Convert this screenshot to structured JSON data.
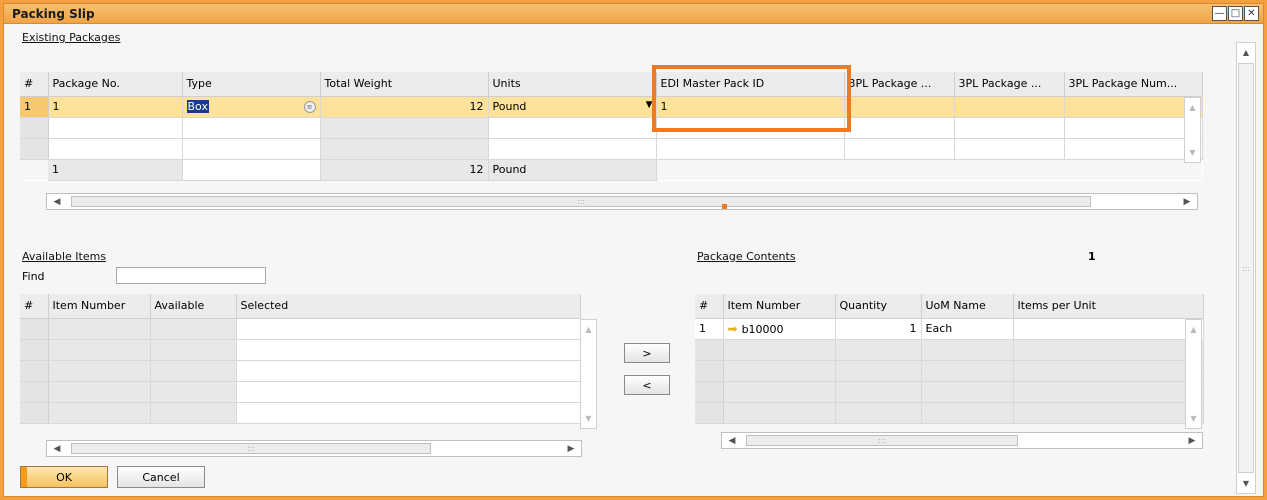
{
  "window": {
    "title": "Packing Slip",
    "controls": [
      "minimize-icon",
      "maximize-icon",
      "close-icon"
    ]
  },
  "existing_packages": {
    "label": "Existing Packages",
    "columns": [
      "#",
      "Package No.",
      "Type",
      "Total Weight",
      "Units",
      "EDI Master Pack ID",
      "3PL Package ...",
      "3PL Package ...",
      "3PL Package Num..."
    ],
    "rows": [
      {
        "num": "1",
        "package_no": "1",
        "type": "Box",
        "total_weight": "12",
        "units": "Pound",
        "edi": "1",
        "c1": "",
        "c2": "",
        "c3": ""
      },
      {
        "num": "",
        "package_no": "",
        "type": "",
        "total_weight": "",
        "units": "",
        "edi": "",
        "c1": "",
        "c2": "",
        "c3": ""
      },
      {
        "num": "",
        "package_no": "",
        "type": "",
        "total_weight": "",
        "units": "",
        "edi": "",
        "c1": "",
        "c2": "",
        "c3": ""
      }
    ],
    "totals": {
      "package_no": "1",
      "total_weight": "12",
      "units": "Pound"
    }
  },
  "available_items": {
    "label": "Available Items",
    "find_label": "Find",
    "find_value": "",
    "columns": [
      "#",
      "Item Number",
      "Available",
      "Selected"
    ]
  },
  "package_contents": {
    "label": "Package Contents",
    "count": "1",
    "columns": [
      "#",
      "Item Number",
      "Quantity",
      "UoM Name",
      "Items per Unit"
    ],
    "rows": [
      {
        "num": "1",
        "item_number": "b10000",
        "quantity": "1",
        "uom": "Each",
        "items_per_unit": ""
      }
    ]
  },
  "transfer": {
    "add_label": ">",
    "remove_label": "<"
  },
  "buttons": {
    "ok": "OK",
    "cancel": "Cancel"
  },
  "colors": {
    "accent": "#f39c1a",
    "selected_row": "#fde39a",
    "highlight": "#f07a20"
  }
}
